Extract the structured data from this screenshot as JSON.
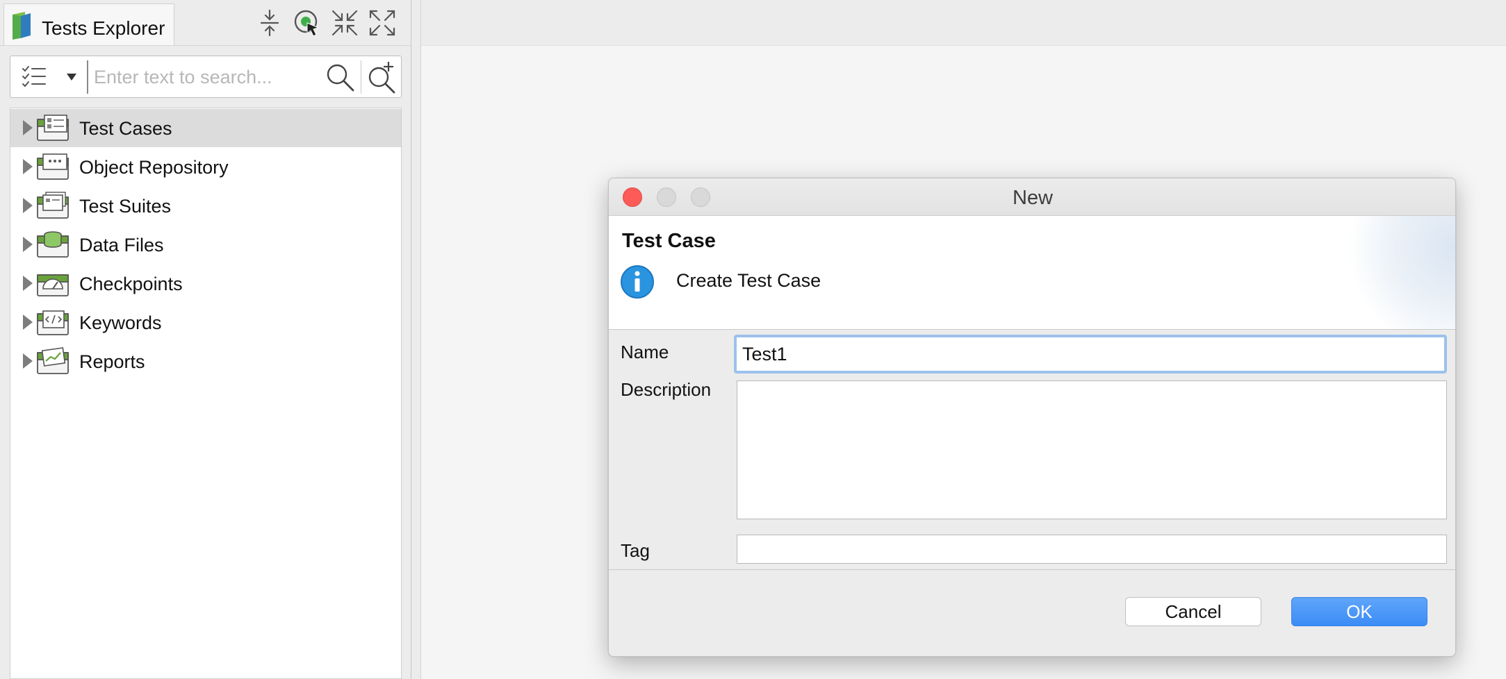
{
  "explorer": {
    "tab_title": "Tests Explorer",
    "toolbar_icons": [
      "collapse-all-icon",
      "link-with-editor-icon",
      "minimize-icon",
      "maximize-icon"
    ],
    "search": {
      "placeholder": "Enter text to search...",
      "value": ""
    },
    "tree": [
      {
        "label": "Test Cases",
        "icon": "test-cases-folder-icon",
        "selected": true
      },
      {
        "label": "Object Repository",
        "icon": "object-repository-folder-icon",
        "selected": false
      },
      {
        "label": "Test Suites",
        "icon": "test-suites-folder-icon",
        "selected": false
      },
      {
        "label": "Data Files",
        "icon": "data-files-folder-icon",
        "selected": false
      },
      {
        "label": "Checkpoints",
        "icon": "checkpoints-folder-icon",
        "selected": false
      },
      {
        "label": "Keywords",
        "icon": "keywords-folder-icon",
        "selected": false
      },
      {
        "label": "Reports",
        "icon": "reports-folder-icon",
        "selected": false
      }
    ]
  },
  "dialog": {
    "window_title": "New",
    "heading": "Test Case",
    "message": "Create Test Case",
    "fields": {
      "name_label": "Name",
      "name_value": "Test1",
      "description_label": "Description",
      "description_value": "",
      "tag_label": "Tag",
      "tag_value": ""
    },
    "buttons": {
      "cancel": "Cancel",
      "ok": "OK"
    }
  },
  "colors": {
    "accent": "#3c8cf5",
    "close_button": "#fc5b57",
    "focus_ring": "#9cc1ec",
    "info_icon": "#2a94e0",
    "folder_green": "#6aa33b"
  }
}
